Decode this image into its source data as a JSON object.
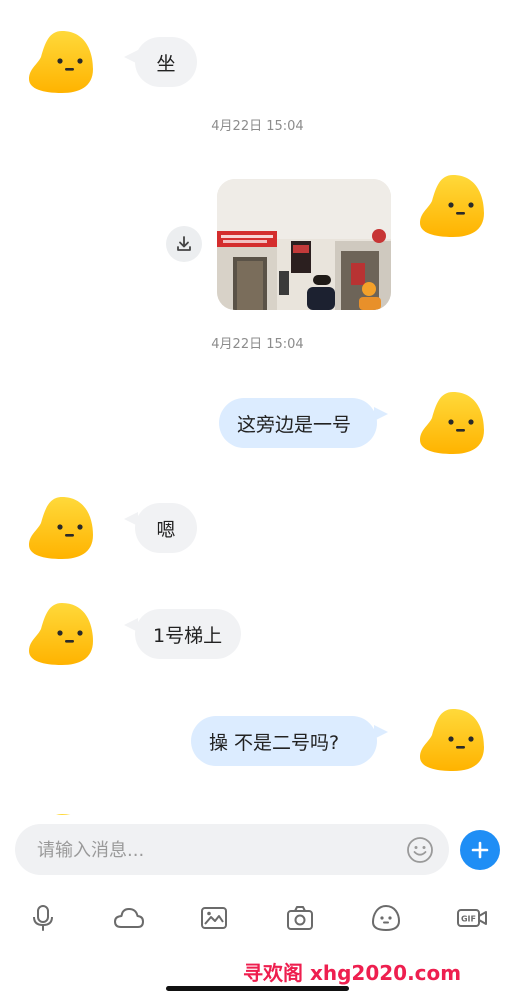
{
  "messages": [
    {
      "id": "m1",
      "direction": "incoming",
      "text": "坐"
    },
    {
      "id": "t1",
      "type": "timestamp",
      "text": "4月22日 15:04"
    },
    {
      "id": "m2",
      "direction": "outgoing",
      "type": "image"
    },
    {
      "id": "t2",
      "type": "timestamp",
      "text": "4月22日 15:04"
    },
    {
      "id": "m3",
      "direction": "outgoing",
      "text": "这旁边是一号"
    },
    {
      "id": "m4",
      "direction": "incoming",
      "text": "嗯"
    },
    {
      "id": "m5",
      "direction": "incoming",
      "text": "1号梯上"
    },
    {
      "id": "m6",
      "direction": "outgoing",
      "text": "操 不是二号吗?"
    }
  ],
  "composer": {
    "placeholder": "请输入消息..."
  },
  "toolbar": {
    "icons": [
      "microphone-icon",
      "cloud-icon",
      "image-icon",
      "camera-icon",
      "sticker-icon",
      "gif-icon"
    ]
  },
  "colors": {
    "incoming_bubble": "#f1f2f4",
    "outgoing_bubble": "#dcecff",
    "send_button": "#1f8ef5",
    "avatar_yellow": "#ffc814"
  },
  "watermark": "寻欢阁 xhg2020.com"
}
